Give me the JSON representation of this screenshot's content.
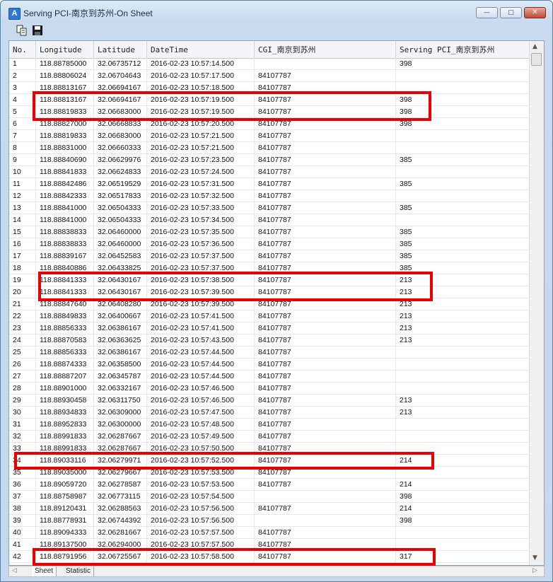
{
  "window": {
    "title": "Serving PCI-南京到苏州-On Sheet",
    "app_icon": "A",
    "buttons": {
      "minimize": "—",
      "maximize": "□",
      "close": "✕"
    }
  },
  "toolbar": {
    "icons": [
      "copy-icon",
      "save-icon"
    ]
  },
  "table": {
    "columns": [
      "No.",
      "Longitude",
      "Latitude",
      "DateTime",
      "CGI_南京到苏州",
      "Serving PCI_南京到苏州"
    ],
    "rows": [
      [
        "1",
        "118.88785000",
        "32.06735712",
        "2016-02-23 10:57:14.500",
        "",
        "398"
      ],
      [
        "2",
        "118.88806024",
        "32.06704643",
        "2016-02-23 10:57:17.500",
        "84107787",
        ""
      ],
      [
        "3",
        "118.88813167",
        "32.06694167",
        "2016-02-23 10:57:18.500",
        "84107787",
        ""
      ],
      [
        "4",
        "118.88813167",
        "32.06694167",
        "2016-02-23 10:57:19.500",
        "84107787",
        "398"
      ],
      [
        "5",
        "118.88819833",
        "32.06683000",
        "2016-02-23 10:57:19.500",
        "84107787",
        "398"
      ],
      [
        "6",
        "118.88827000",
        "32.06668833",
        "2016-02-23 10:57:20.500",
        "84107787",
        "398"
      ],
      [
        "7",
        "118.88819833",
        "32.06683000",
        "2016-02-23 10:57:21.500",
        "84107787",
        ""
      ],
      [
        "8",
        "118.88831000",
        "32.06660333",
        "2016-02-23 10:57:21.500",
        "84107787",
        ""
      ],
      [
        "9",
        "118.88840690",
        "32.06629976",
        "2016-02-23 10:57:23.500",
        "84107787",
        "385"
      ],
      [
        "10",
        "118.88841833",
        "32.06624833",
        "2016-02-23 10:57:24.500",
        "84107787",
        ""
      ],
      [
        "11",
        "118.88842486",
        "32.06519529",
        "2016-02-23 10:57:31.500",
        "84107787",
        "385"
      ],
      [
        "12",
        "118.88842333",
        "32.06517833",
        "2016-02-23 10:57:32.500",
        "84107787",
        ""
      ],
      [
        "13",
        "118.88841000",
        "32.06504333",
        "2016-02-23 10:57:33.500",
        "84107787",
        "385"
      ],
      [
        "14",
        "118.88841000",
        "32.06504333",
        "2016-02-23 10:57:34.500",
        "84107787",
        ""
      ],
      [
        "15",
        "118.88838833",
        "32.06460000",
        "2016-02-23 10:57:35.500",
        "84107787",
        "385"
      ],
      [
        "16",
        "118.88838833",
        "32.06460000",
        "2016-02-23 10:57:36.500",
        "84107787",
        "385"
      ],
      [
        "17",
        "118.88839167",
        "32.06452583",
        "2016-02-23 10:57:37.500",
        "84107787",
        "385"
      ],
      [
        "18",
        "118.88840886",
        "32.06433825",
        "2016-02-23 10:57:37.500",
        "84107787",
        "385"
      ],
      [
        "19",
        "118.88841333",
        "32.06430167",
        "2016-02-23 10:57:38.500",
        "84107787",
        "213"
      ],
      [
        "20",
        "118.88841333",
        "32.06430167",
        "2016-02-23 10:57:39.500",
        "84107787",
        "213"
      ],
      [
        "21",
        "118.88847640",
        "32.06408280",
        "2016-02-23 10:57:39.500",
        "84107787",
        "213"
      ],
      [
        "22",
        "118.88849833",
        "32.06400667",
        "2016-02-23 10:57:41.500",
        "84107787",
        "213"
      ],
      [
        "23",
        "118.88856333",
        "32.06386167",
        "2016-02-23 10:57:41.500",
        "84107787",
        "213"
      ],
      [
        "24",
        "118.88870583",
        "32.06363625",
        "2016-02-23 10:57:43.500",
        "84107787",
        "213"
      ],
      [
        "25",
        "118.88856333",
        "32.06386167",
        "2016-02-23 10:57:44.500",
        "84107787",
        ""
      ],
      [
        "26",
        "118.88874333",
        "32.06358500",
        "2016-02-23 10:57:44.500",
        "84107787",
        ""
      ],
      [
        "27",
        "118.88887207",
        "32.06345787",
        "2016-02-23 10:57:44.500",
        "84107787",
        ""
      ],
      [
        "28",
        "118.88901000",
        "32.06332167",
        "2016-02-23 10:57:46.500",
        "84107787",
        ""
      ],
      [
        "29",
        "118.88930458",
        "32.06311750",
        "2016-02-23 10:57:46.500",
        "84107787",
        "213"
      ],
      [
        "30",
        "118.88934833",
        "32.06309000",
        "2016-02-23 10:57:47.500",
        "84107787",
        "213"
      ],
      [
        "31",
        "118.88952833",
        "32.06300000",
        "2016-02-23 10:57:48.500",
        "84107787",
        ""
      ],
      [
        "32",
        "118.88991833",
        "32.06287667",
        "2016-02-23 10:57:49.500",
        "84107787",
        ""
      ],
      [
        "33",
        "118.88991833",
        "32.06287667",
        "2016-02-23 10:57:50.500",
        "84107787",
        ""
      ],
      [
        "34",
        "118.89033116",
        "32.06279971",
        "2016-02-23 10:57:52.500",
        "84107787",
        "214"
      ],
      [
        "35",
        "118.89035000",
        "32.06279667",
        "2016-02-23 10:57:53.500",
        "84107787",
        ""
      ],
      [
        "36",
        "118.89059720",
        "32.06278587",
        "2016-02-23 10:57:53.500",
        "84107787",
        "214"
      ],
      [
        "37",
        "118.88758987",
        "32.06773115",
        "2016-02-23 10:57:54.500",
        "",
        "398"
      ],
      [
        "38",
        "118.89120431",
        "32.06288563",
        "2016-02-23 10:57:56.500",
        "84107787",
        "214"
      ],
      [
        "39",
        "118.88778931",
        "32.06744392",
        "2016-02-23 10:57:56.500",
        "",
        "398"
      ],
      [
        "40",
        "118.89094333",
        "32.06281667",
        "2016-02-23 10:57:57.500",
        "84107787",
        ""
      ],
      [
        "41",
        "118.89137500",
        "32.06294000",
        "2016-02-23 10:57:57.500",
        "84107787",
        ""
      ],
      [
        "42",
        "118.88791956",
        "32.06725567",
        "2016-02-23 10:57:58.500",
        "84107787",
        "317"
      ]
    ]
  },
  "highlights": [
    {
      "rows": [
        4,
        5
      ]
    },
    {
      "rows": [
        19,
        20
      ]
    },
    {
      "rows": [
        34
      ]
    },
    {
      "rows": [
        42
      ]
    }
  ],
  "sheet_tabs": [
    "Sheet",
    "Statistic"
  ],
  "accent_colors": {
    "highlight": "#e60000",
    "title_bar": "#c8daee"
  }
}
